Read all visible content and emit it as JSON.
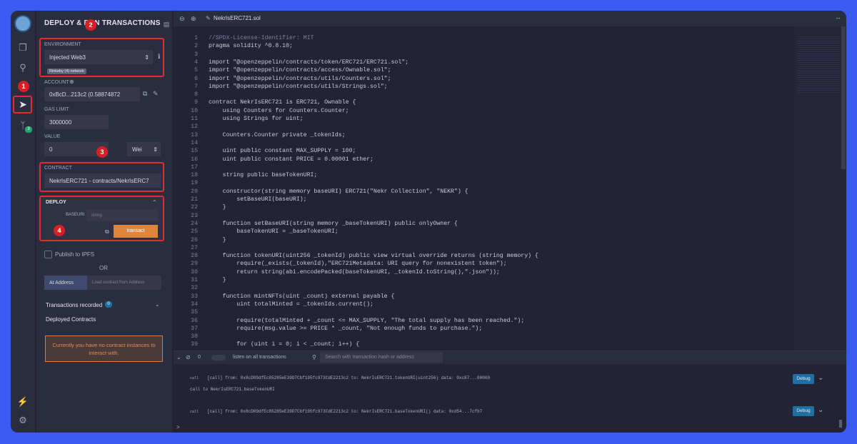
{
  "iconbar": {
    "icons": [
      "remix-logo",
      "file-explorer-icon",
      "search-icon",
      "deploy-icon",
      "git-icon",
      "plug-icon",
      "settings-icon"
    ],
    "git_badge": "3"
  },
  "panel": {
    "title": "DEPLOY & RUN TRANSACTIONS",
    "environment": {
      "label": "ENVIRONMENT",
      "value": "Injected Web3",
      "network": "Rinkeby (4) network"
    },
    "account": {
      "label": "ACCOUNT",
      "value": "0xBcD...213c2 (0.58874872"
    },
    "gas_limit": {
      "label": "GAS LIMIT",
      "value": "3000000"
    },
    "value": {
      "label": "VALUE",
      "amount": "0",
      "unit": "Wei"
    },
    "contract": {
      "label": "CONTRACT",
      "value": "NekrIsERC721 - contracts/NekrIsERC7"
    },
    "deploy": {
      "header": "DEPLOY",
      "param_label": "BASEURI",
      "param_placeholder": "string",
      "button": "transact"
    },
    "publish": "Publish to IPFS",
    "or": "OR",
    "at_address": "At Address",
    "load_placeholder": "Load contract from Address",
    "transactions_recorded": "Transactions recorded",
    "tx_count": "0",
    "deployed": "Deployed Contracts",
    "warning": "Currently you have no contract instances to interact with."
  },
  "callouts": [
    "1",
    "2",
    "3",
    "4"
  ],
  "editor": {
    "file_tab": "NekrIsERC721.sol",
    "lines": [
      "//SPDX-License-Identifier: MIT",
      "pragma solidity ^0.8.10;",
      "",
      "import \"@openzeppelin/contracts/token/ERC721/ERC721.sol\";",
      "import \"@openzeppelin/contracts/access/Ownable.sol\";",
      "import \"@openzeppelin/contracts/utils/Counters.sol\";",
      "import \"@openzeppelin/contracts/utils/Strings.sol\";",
      "",
      "contract NekrIsERC721 is ERC721, Ownable {",
      "    using Counters for Counters.Counter;",
      "    using Strings for uint;",
      "",
      "    Counters.Counter private _tokenIds;",
      "",
      "    uint public constant MAX_SUPPLY = 100;",
      "    uint public constant PRICE = 0.00001 ether;",
      "",
      "    string public baseTokenURI;",
      "",
      "    constructor(string memory baseURI) ERC721(\"Nekr Collection\", \"NEKR\") {",
      "        setBaseURI(baseURI);",
      "    }",
      "",
      "    function setBaseURI(string memory _baseTokenURI) public onlyOwner {",
      "        baseTokenURI = _baseTokenURI;",
      "    }",
      "",
      "    function tokenURI(uint256 _tokenId) public view virtual override returns (string memory) {",
      "        require(_exists(_tokenId),\"ERC721Metadata: URI query for nonexistent token\");",
      "        return string(abi.encodePacked(baseTokenURI, _tokenId.toString(),\".json\"));",
      "    }",
      "",
      "    function mintNFTs(uint _count) external payable {",
      "        uint totalMinted = _tokenIds.current();",
      "",
      "        require(totalMinted + _count <= MAX_SUPPLY, \"The total supply has been reached.\");",
      "        require(msg.value >= PRICE * _count, \"Not enough funds to purchase.\");",
      "",
      "        for (uint i = 0; i < _count; i++) {"
    ]
  },
  "terminal": {
    "count": "0",
    "listen_label": "listen on all transactions",
    "search_placeholder": "Search with transaction hash or address",
    "entries": [
      {
        "tag": "call",
        "text": "[call]  from: 0x8cD09dfEc85285eE39D7Cbf195fc973CdE2213c2 to: NekrIsERC721.tokenURI(uint256) data: 0xc87...00000",
        "debug": "Debug"
      },
      {
        "tag": "",
        "text": "call to NekrIsERC721.baseTokenURI",
        "debug": ""
      },
      {
        "tag": "call",
        "text": "[call]  from: 0x8cD09dfEc85285eE39D7Cbf195fc973CdE2213c2 to: NekrIsERC721.baseTokenURI() data: 0xd54...7cfb7",
        "debug": "Debug"
      }
    ],
    "prompt": ">"
  }
}
